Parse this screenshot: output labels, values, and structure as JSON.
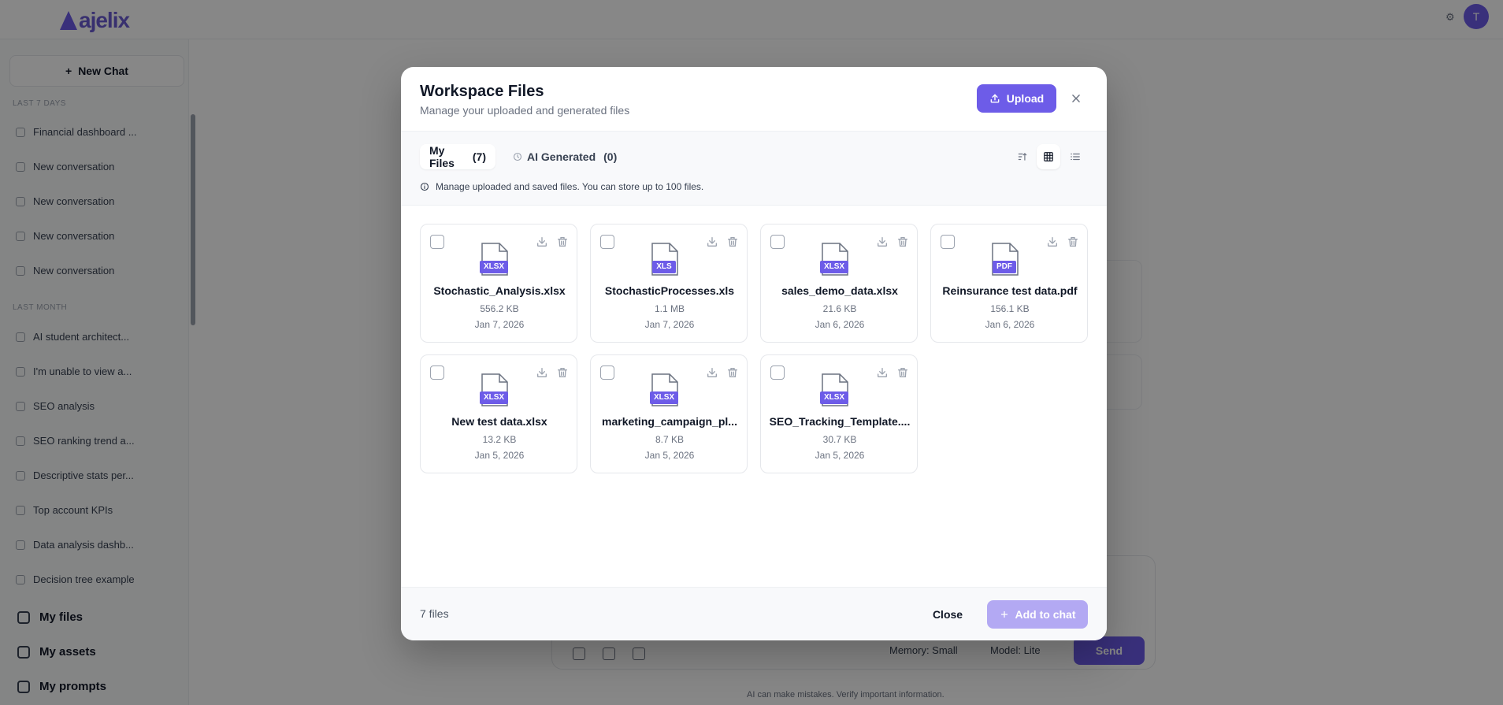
{
  "background": {
    "brand": "ajelix",
    "avatar_initial": "T",
    "new_chat_label": "New Chat",
    "sections": [
      {
        "title": "Last 7 days",
        "items": [
          "Financial dashboard ...",
          "New conversation",
          "New conversation",
          "New conversation",
          "New conversation"
        ]
      },
      {
        "title": "Last month",
        "items": [
          "AI student architect...",
          "I'm unable to view a...",
          "SEO analysis",
          "SEO ranking trend a...",
          "Descriptive stats per...",
          "Top account KPIs",
          "Data analysis dashb...",
          "Decision tree example"
        ]
      }
    ],
    "nav": [
      "My files",
      "My assets",
      "My prompts"
    ],
    "composer": {
      "memory_label": "Memory: Small",
      "model_label": "Model: Lite",
      "send_label": "Send"
    },
    "disclaimer": "AI can make mistakes. Verify important information."
  },
  "modal": {
    "title": "Workspace Files",
    "subtitle": "Manage your uploaded and generated files",
    "upload_label": "Upload",
    "tabs": [
      {
        "label": "My Files",
        "count": "(7)"
      },
      {
        "label": "AI Generated",
        "count": "(0)"
      }
    ],
    "info_text": "Manage uploaded and saved files. You can store up to 100 files.",
    "files": [
      {
        "name": "Stochastic_Analysis.xlsx",
        "type": "XLSX",
        "size": "556.2 KB",
        "date": "Jan 7, 2026"
      },
      {
        "name": "StochasticProcesses.xls",
        "type": "XLS",
        "size": "1.1 MB",
        "date": "Jan 7, 2026"
      },
      {
        "name": "sales_demo_data.xlsx",
        "type": "XLSX",
        "size": "21.6 KB",
        "date": "Jan 6, 2026"
      },
      {
        "name": "Reinsurance test data.pdf",
        "type": "PDF",
        "size": "156.1 KB",
        "date": "Jan 6, 2026"
      },
      {
        "name": "New test data.xlsx",
        "type": "XLSX",
        "size": "13.2 KB",
        "date": "Jan 5, 2026"
      },
      {
        "name": "marketing_campaign_pl...",
        "type": "XLSX",
        "size": "8.7 KB",
        "date": "Jan 5, 2026"
      },
      {
        "name": "SEO_Tracking_Template....",
        "type": "XLSX",
        "size": "30.7 KB",
        "date": "Jan 5, 2026"
      }
    ],
    "footer": {
      "count_text": "7 files",
      "close_label": "Close",
      "add_label": "Add to chat"
    }
  },
  "colors": {
    "accent": "#6d5ce8",
    "accent_disabled": "#b3a9f3"
  }
}
